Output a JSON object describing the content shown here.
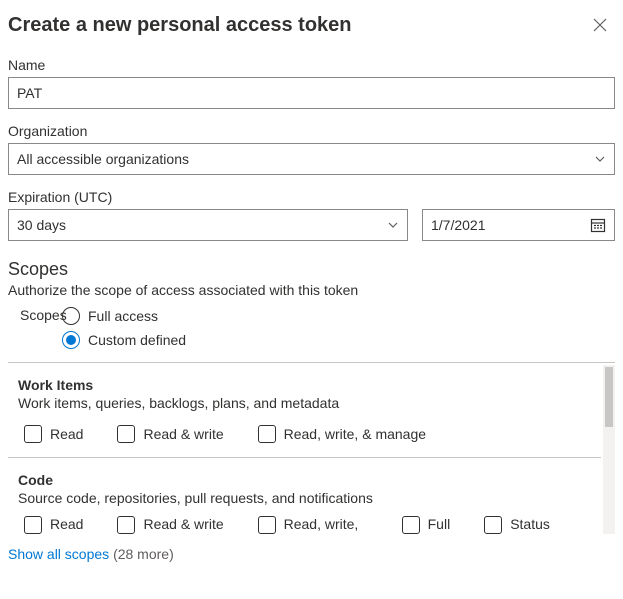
{
  "header": {
    "title": "Create a new personal access token"
  },
  "fields": {
    "name_label": "Name",
    "name_value": "PAT",
    "org_label": "Organization",
    "org_value": "All accessible organizations",
    "exp_label": "Expiration (UTC)",
    "exp_select_value": "30 days",
    "exp_date_value": "1/7/2021"
  },
  "scopes": {
    "heading": "Scopes",
    "subtext": "Authorize the scope of access associated with this token",
    "radio_label": "Scopes",
    "options": {
      "full": "Full access",
      "custom": "Custom defined"
    }
  },
  "groups": [
    {
      "title": "Work Items",
      "desc": "Work items, queries, backlogs, plans, and metadata",
      "perms": [
        "Read",
        "Read & write",
        "Read, write, & manage"
      ]
    },
    {
      "title": "Code",
      "desc": "Source code, repositories, pull requests, and notifications",
      "perms": [
        "Read",
        "Read & write",
        "Read, write, & manage",
        "Full",
        "Status"
      ]
    }
  ],
  "footer": {
    "link_text": "Show all scopes",
    "count_text": "(28 more)"
  }
}
